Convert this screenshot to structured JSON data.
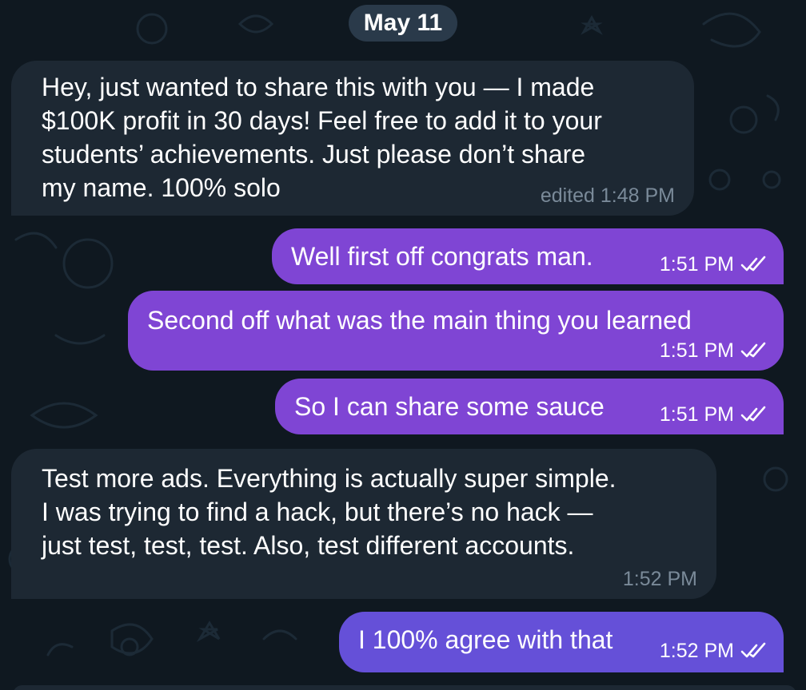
{
  "date_separator": "May 11",
  "colors": {
    "background": "#0f1820",
    "incoming_bubble": "#1d2833",
    "outgoing_bubble": "#7f45d4",
    "outgoing_bubble_latest": "#6550d8",
    "incoming_time": "#7a8a99",
    "date_pill": "#2a3a4a"
  },
  "messages": [
    {
      "direction": "incoming",
      "lines": [
        "Hey, just wanted to share this with you — I made",
        "$100K profit in 30 days! Feel free to add it to your",
        "students’ achievements. Just please don’t share",
        "my name. 100% solo"
      ],
      "time": "edited 1:48 PM"
    },
    {
      "direction": "outgoing",
      "lines": [
        "Well first off congrats man."
      ],
      "time": "1:51 PM",
      "status_icon": "double-check-icon"
    },
    {
      "direction": "outgoing",
      "lines": [
        "Second off what was the main thing you learned"
      ],
      "time": "1:51 PM",
      "status_icon": "double-check-icon"
    },
    {
      "direction": "outgoing",
      "lines": [
        "So I can share some sauce"
      ],
      "time": "1:51 PM",
      "status_icon": "double-check-icon"
    },
    {
      "direction": "incoming",
      "lines": [
        "Test more ads. Everything is actually super simple.",
        "I was trying to find a hack, but there’s no hack —",
        "just test, test, test. Also, test different accounts."
      ],
      "time": "1:52 PM"
    },
    {
      "direction": "outgoing",
      "lines": [
        "I 100% agree with that"
      ],
      "time": "1:52 PM",
      "status_icon": "double-check-icon"
    }
  ]
}
